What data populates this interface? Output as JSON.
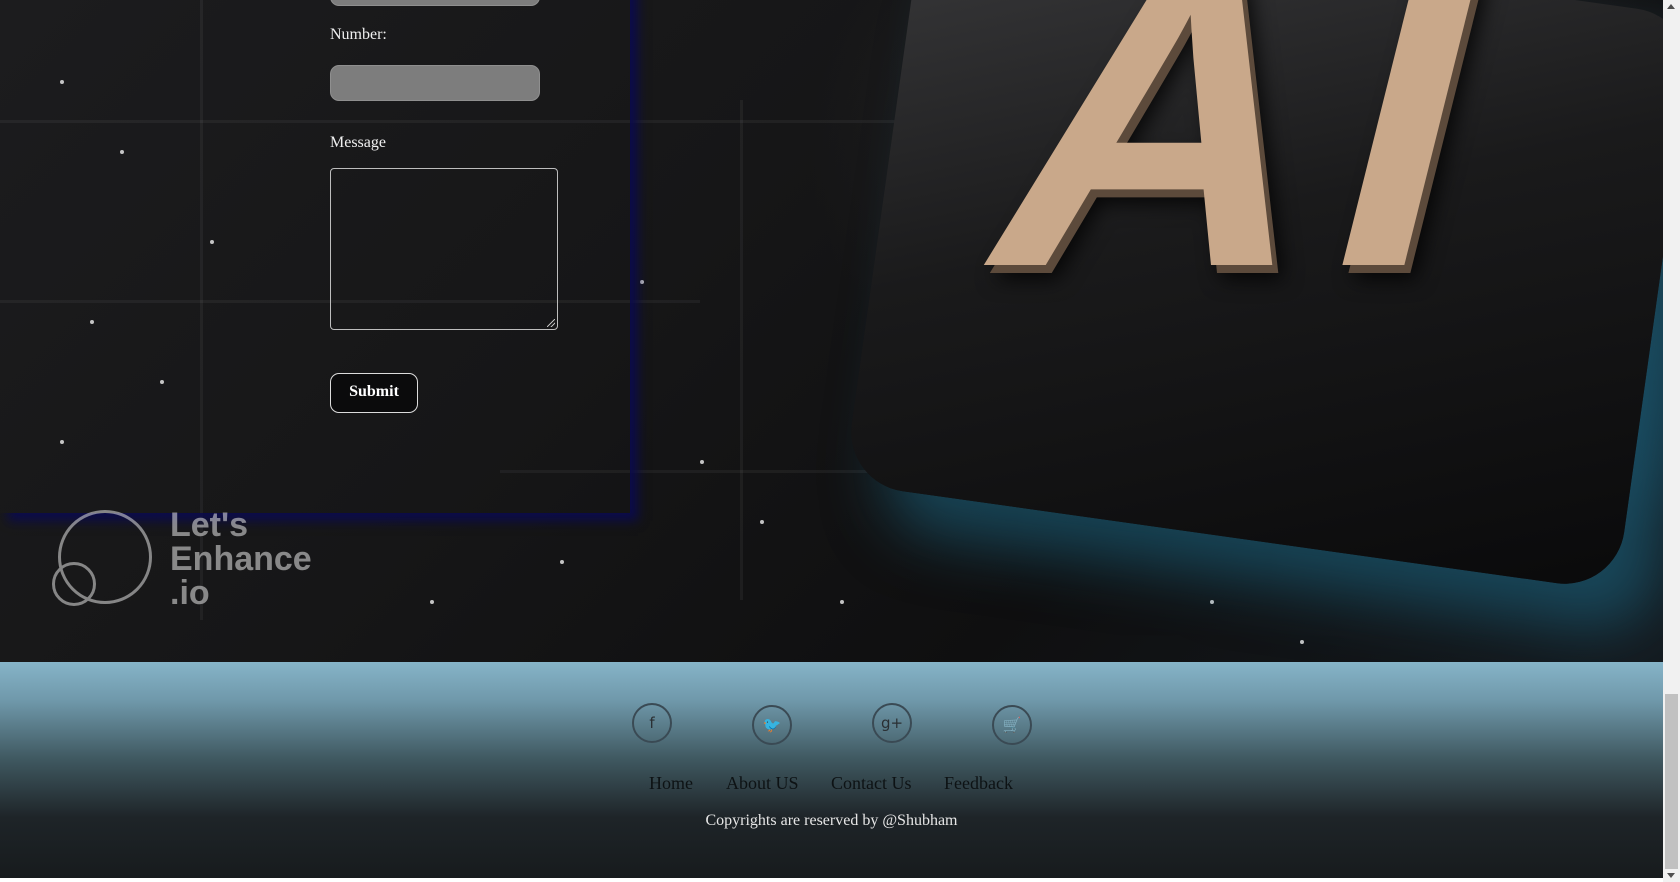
{
  "hero": {
    "background_graphic": "AI",
    "watermark": {
      "line1": "Let's",
      "line2": "Enhance",
      "line3": ".io"
    }
  },
  "form": {
    "number_label": "Number:",
    "message_label": "Message",
    "submit_label": "Submit"
  },
  "footer": {
    "social": [
      {
        "name": "facebook-icon",
        "glyph": "f"
      },
      {
        "name": "twitter-icon",
        "glyph": "🐦"
      },
      {
        "name": "google-plus-icon",
        "glyph": "g+"
      },
      {
        "name": "cart-icon",
        "glyph": "🛒"
      }
    ],
    "links": [
      "Home",
      "About US",
      "Contact Us",
      "Feedback"
    ],
    "copyright": "Copyrights are reserved by @Shubham"
  }
}
